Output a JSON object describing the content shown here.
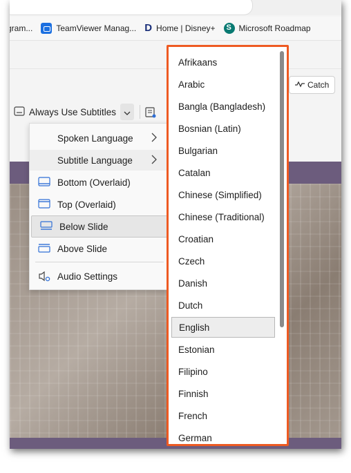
{
  "bookmarks": [
    {
      "label": "gram...",
      "icon": "program-icon"
    },
    {
      "label": "TeamViewer Manag...",
      "icon": "teamviewer-icon"
    },
    {
      "label": "Home | Disney+",
      "icon": "disney-icon"
    },
    {
      "label": "Microsoft Roadmap",
      "icon": "sharepoint-icon"
    }
  ],
  "toolbar": {
    "subtitles_button_label": "Always Use Subtitles",
    "catch_label": "Catch"
  },
  "menu": {
    "items": [
      {
        "label": "Spoken Language",
        "icon": "",
        "submenu": true
      },
      {
        "label": "Subtitle Language",
        "icon": "",
        "submenu": true
      },
      {
        "label": "Bottom (Overlaid)",
        "icon": "subtitle-bottom-icon",
        "submenu": false
      },
      {
        "label": "Top (Overlaid)",
        "icon": "subtitle-top-icon",
        "submenu": false
      },
      {
        "label": "Below Slide",
        "icon": "subtitle-below-icon",
        "submenu": false,
        "selected": true
      },
      {
        "label": "Above Slide",
        "icon": "subtitle-above-icon",
        "submenu": false
      },
      {
        "label": "Audio Settings",
        "icon": "audio-settings-icon",
        "submenu": false
      }
    ]
  },
  "languages": {
    "items": [
      "Afrikaans",
      "Arabic",
      "Bangla (Bangladesh)",
      "Bosnian (Latin)",
      "Bulgarian",
      "Catalan",
      "Chinese (Simplified)",
      "Chinese (Traditional)",
      "Croatian",
      "Czech",
      "Danish",
      "Dutch",
      "English",
      "Estonian",
      "Filipino",
      "Finnish",
      "French",
      "German"
    ],
    "selected": "English"
  },
  "colors": {
    "highlight_border": "#ee5a22",
    "slide_band": "#6c5c7d"
  }
}
